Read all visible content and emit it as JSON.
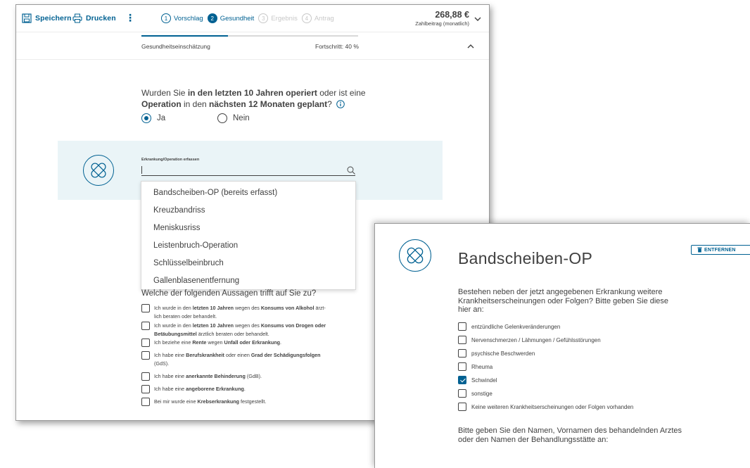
{
  "topbar": {
    "save_label": "Speichern",
    "print_label": "Drucken",
    "more_label": "⋮",
    "steps": [
      {
        "num": "1",
        "label": "Vorschlag",
        "state": "done"
      },
      {
        "num": "2",
        "label": "Gesundheit",
        "state": "active"
      },
      {
        "num": "3",
        "label": "Ergebnis",
        "state": "todo"
      },
      {
        "num": "4",
        "label": "Antrag",
        "state": "todo"
      }
    ],
    "price": "268,88 €",
    "price_sub": "Zahlbeitrag (monatlich)"
  },
  "progress": {
    "label": "Gesundheitseinschätzung",
    "text": "Fortschritt: 40 %",
    "value": 0.4
  },
  "question1": {
    "part1": "Wurden Sie ",
    "bold1": "in den letzten 10 Jahren operiert",
    "part2": " oder ist eine ",
    "bold2": "Operation",
    "part3": " in den ",
    "bold3": "nächsten 12 Monaten geplant",
    "part4": "?",
    "yes": "Ja",
    "no": "Nein",
    "selected": "Ja"
  },
  "search": {
    "label": "Erkrankung/Operation erfassen",
    "value": ""
  },
  "dropdown": [
    "Bandscheiben-OP (bereits erfasst)",
    "Kreuzbandriss",
    "Meniskusriss",
    "Leistenbruch-Operation",
    "Schlüsselbeinbruch",
    "Gallenblasenentfernung"
  ],
  "question2": {
    "title": "Welche der folgenden Aussagen trifft auf Sie zu?",
    "items": [
      {
        "a": "Ich wurde in den ",
        "b": "letzten 10 Jahren",
        "c": " wegen des ",
        "d": "Konsums von Alkohol",
        "e": " ärzt-",
        "f": "lich beraten oder behandelt."
      },
      {
        "a": "Ich wurde in den ",
        "b": "letzten 10 Jahren",
        "c": " wegen des ",
        "d": "Konsums von Drogen oder",
        "e": "",
        "f": "",
        "g": "Betäubungsmittel",
        "h": " ärztlich beraten oder behandelt."
      },
      {
        "a": "Ich beziehe eine ",
        "b": "Rente",
        "c": " wegen ",
        "d": "Unfall oder Erkrankung",
        "e": "."
      },
      {
        "a": "Ich habe eine ",
        "b": "Berufskrankheit",
        "c": " oder einen ",
        "d": "Grad der Schädigungsfolgen",
        "e": "",
        "f": "(GdS)."
      },
      {
        "a": "Ich habe eine ",
        "b": "anerkannte Behinderung",
        "c": " (GdB)."
      },
      {
        "a": "Ich habe eine ",
        "b": "angeborene Erkrankung",
        "c": "."
      },
      {
        "a": "Bei mir wurde eine ",
        "b": "Krebserkrankung",
        "c": " festgestellt."
      }
    ]
  },
  "panel2": {
    "title": "Bandscheiben-OP",
    "remove_label": "ENTFERNEN",
    "question": "Bestehen neben der jetzt angegebenen Erkrankung weitere Krankheitserscheinungen oder Folgen? Bitte geben Sie diese hier an:",
    "options": [
      {
        "label": "entzündliche Gelenkveränderungen",
        "checked": false
      },
      {
        "label": "Nervenschmerzen / Lähmungen / Gefühlsstörungen",
        "checked": false
      },
      {
        "label": "psychische Beschwerden",
        "checked": false
      },
      {
        "label": "Rheuma",
        "checked": false
      },
      {
        "label": "Schwindel",
        "checked": true
      },
      {
        "label": "sonstige",
        "checked": false
      },
      {
        "label": "Keine weiteren Krankheitserscheinungen oder Folgen vorhanden",
        "checked": false
      }
    ],
    "question2": "Bitte geben Sie den Namen, Vornamen des behandelnden Arztes oder den Namen der Behandlungsstätte an:"
  },
  "colors": {
    "primary": "#006192",
    "text": "#414141",
    "panel_bg": "#eaf4f7"
  }
}
